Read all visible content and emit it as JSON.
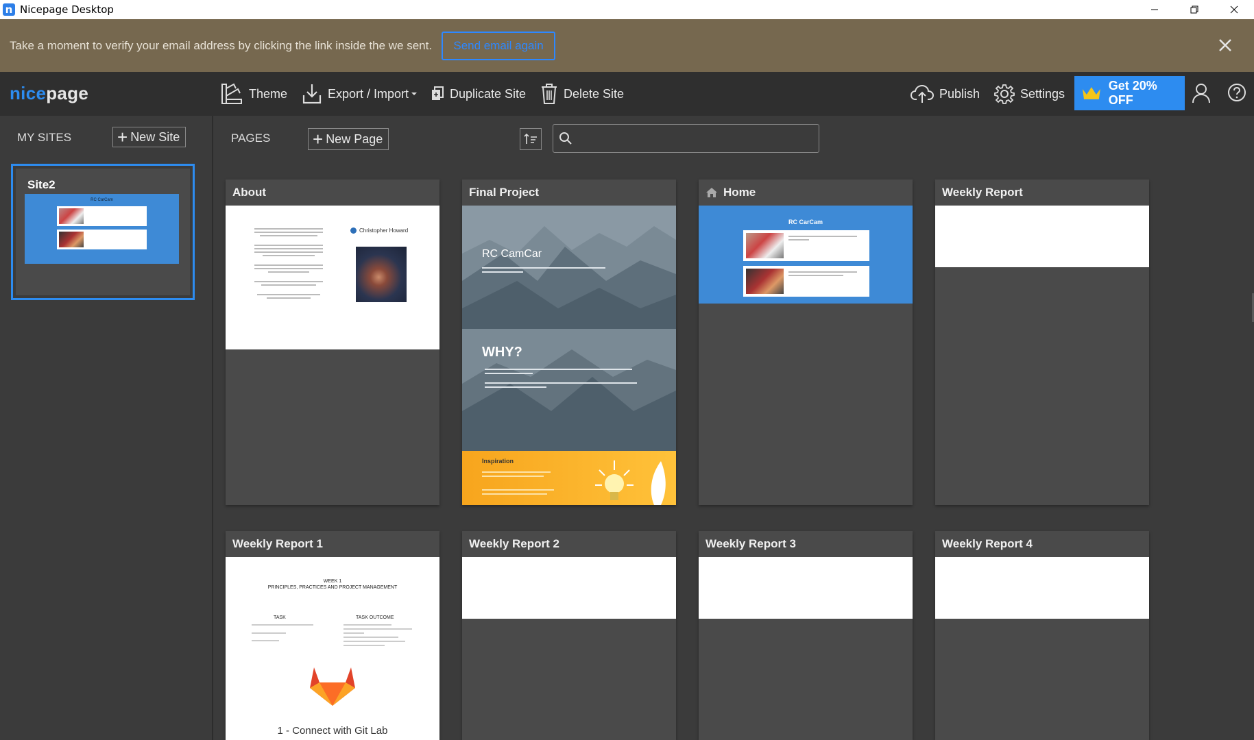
{
  "window": {
    "title": "Nicepage Desktop"
  },
  "banner": {
    "message": "Take a moment to verify your email address by clicking the link inside the we sent.",
    "button_label": "Send email again"
  },
  "toolbar": {
    "logo_nice": "nice",
    "logo_page": "page",
    "theme": "Theme",
    "export_import": "Export / Import",
    "duplicate_site": "Duplicate Site",
    "delete_site": "Delete Site",
    "publish": "Publish",
    "settings": "Settings",
    "promo": "Get 20% OFF"
  },
  "sidebar": {
    "heading": "MY SITES",
    "new_site": "New Site",
    "site": {
      "name": "Site2",
      "thumb_title": "RC CarCam"
    }
  },
  "pages_panel": {
    "heading": "PAGES",
    "new_page": "New Page",
    "search_placeholder": ""
  },
  "pages": [
    {
      "title": "About",
      "author": "Christopher Howard"
    },
    {
      "title": "Final Project",
      "hero": "RC CamCar",
      "why": "WHY?",
      "inspiration": "Inspiration"
    },
    {
      "title": "Home",
      "thumb_title": "RC CarCam"
    },
    {
      "title": "Weekly Report"
    },
    {
      "title": "Weekly Report 1",
      "week": "WEEK 1",
      "subtitle": "PRINCIPLES, PRACTICES AND PROJECT MANAGEMENT",
      "col1": "TASK",
      "col2": "TASK OUTCOME",
      "caption": "1 - Connect with Git Lab"
    },
    {
      "title": "Weekly Report 2"
    },
    {
      "title": "Weekly Report 3"
    },
    {
      "title": "Weekly Report 4"
    }
  ],
  "colors": {
    "accent": "#2d8cf0",
    "banner": "#76684f",
    "toolbar": "#2f2f2f",
    "card": "#4a4a4a"
  }
}
